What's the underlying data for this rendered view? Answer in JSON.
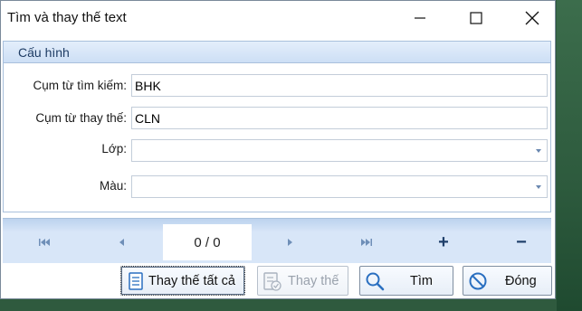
{
  "window": {
    "title": "Tìm và thay thế text"
  },
  "config": {
    "group_title": "Cấu hình",
    "fields": [
      {
        "label": "Cụm từ tìm kiếm:",
        "value": "BHK"
      },
      {
        "label": "Cụm từ thay thế:",
        "value": "CLN"
      },
      {
        "label": "Lớp:",
        "value": ""
      },
      {
        "label": "Màu:",
        "value": ""
      }
    ]
  },
  "navigator": {
    "position": "0 / 0",
    "add_symbol": "+",
    "remove_symbol": "−"
  },
  "buttons": {
    "replace_all": "Thay thế tất cả",
    "replace": "Thay thế",
    "find": "Tìm",
    "close": "Đóng"
  },
  "icons": {
    "first": "first-record-icon",
    "prev": "prev-record-icon",
    "next": "next-record-icon",
    "last": "last-record-icon",
    "replace_all": "document-list-icon",
    "replace": "document-check-icon",
    "find": "magnifier-icon",
    "close": "no-entry-icon"
  },
  "colors": {
    "group_header": "#cddff5",
    "nav_bar": "#d8e6f8",
    "accent": "#2a6fc0"
  }
}
